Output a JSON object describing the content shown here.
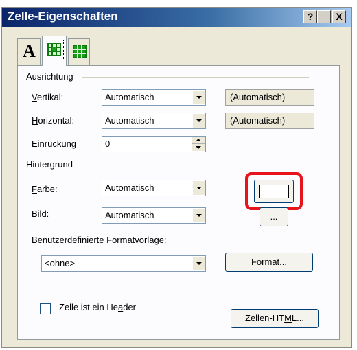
{
  "window": {
    "title": "Zelle-Eigenschaften",
    "help_label": "?",
    "minimize_label": "_",
    "close_label": "X"
  },
  "tabs": [
    {
      "icon": "text-format-icon",
      "label": "A"
    },
    {
      "icon": "cell-grid-icon"
    },
    {
      "icon": "table-grid-icon"
    }
  ],
  "alignment": {
    "group_label": "Ausrichtung",
    "vertical": {
      "label_u": "V",
      "label_rest": "ertikal:",
      "value": "Automatisch",
      "info": "(Automatisch)"
    },
    "horizontal": {
      "label_u": "H",
      "label_rest": "orizontal:",
      "value": "Automatisch",
      "info": "(Automatisch)"
    },
    "indent": {
      "label": "Einrückung",
      "value": "0"
    }
  },
  "background": {
    "group_label": "Hintergrund",
    "color": {
      "label_u": "F",
      "label_rest": "arbe:",
      "value": "Automatisch",
      "swatch": "#ffffff"
    },
    "image": {
      "label_u": "B",
      "label_rest": "ild:",
      "value": "Automatisch",
      "browse_label": "..."
    }
  },
  "custom_style": {
    "label_u": "B",
    "label_rest": "enutzerdefinierte Formatvorlage:",
    "value": "<ohne>",
    "format_button": "Format..."
  },
  "header_checkbox": {
    "label_pre": "Zelle ist ein He",
    "label_u": "a",
    "label_post": "der",
    "checked": false
  },
  "cell_html_button": {
    "label_pre": "Zellen-HT",
    "label_u": "M",
    "label_post": "L..."
  },
  "highlight_color": "#e8141b"
}
